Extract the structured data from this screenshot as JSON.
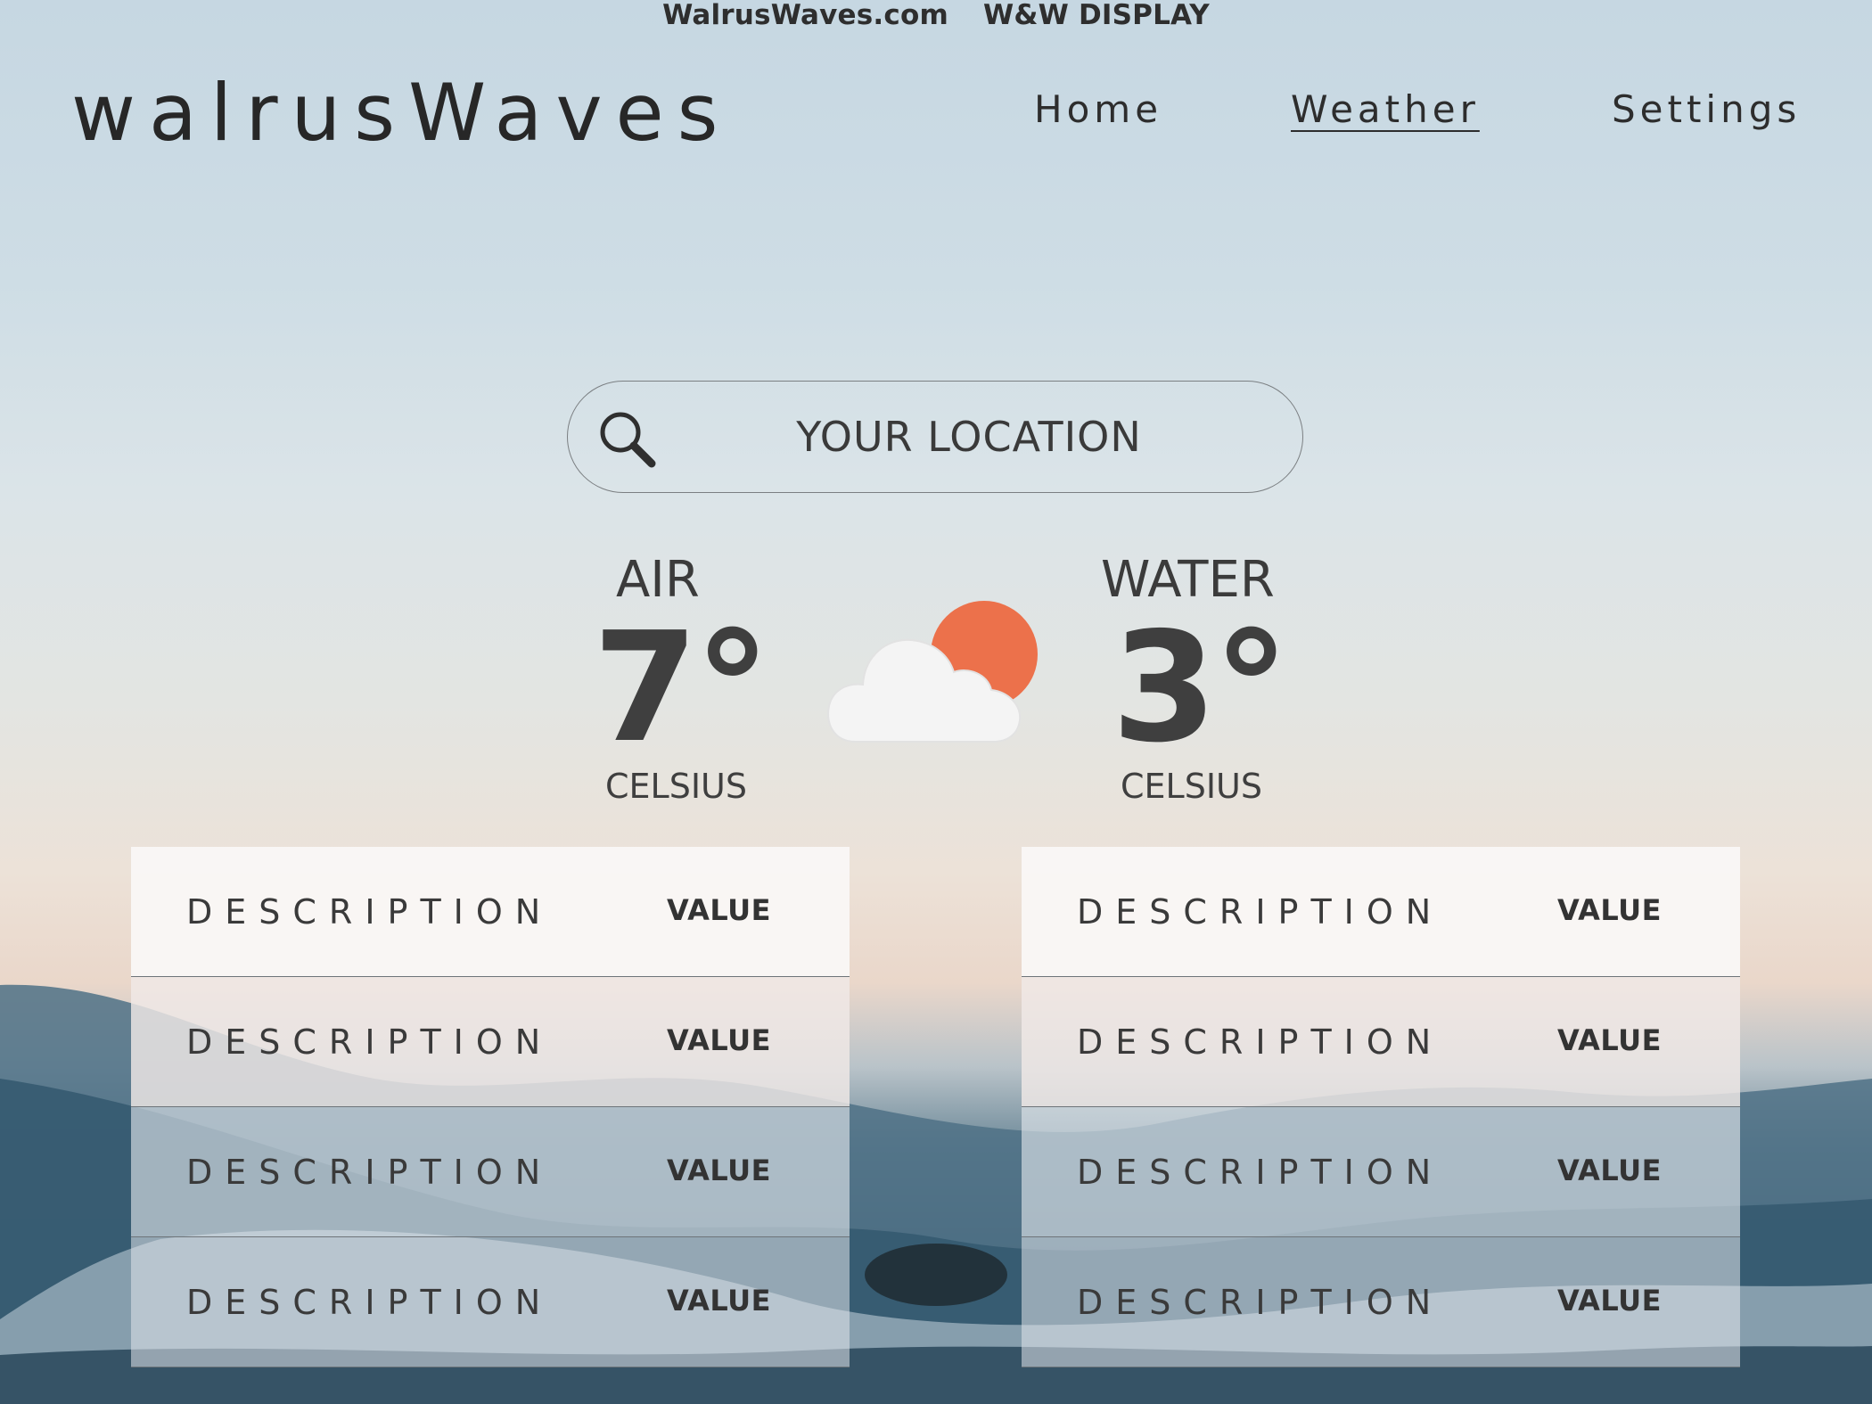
{
  "topbar": {
    "site": "WalrusWaves.com",
    "tag": "W&W DISPLAY"
  },
  "brand": {
    "logo": "walrusWaves"
  },
  "nav": {
    "items": [
      {
        "label": "Home",
        "active": false
      },
      {
        "label": "Weather",
        "active": true
      },
      {
        "label": "Settings",
        "active": false
      }
    ]
  },
  "search": {
    "placeholder": "YOUR LOCATION",
    "icon": "search-icon"
  },
  "air": {
    "label": "AIR",
    "value": "7°",
    "unit": "CELSIUS"
  },
  "water": {
    "label": "WATER",
    "value": "3°",
    "unit": "CELSIUS"
  },
  "condition": {
    "icon": "partly-cloudy-icon",
    "sun_color": "#ec714b",
    "cloud_color": "#f4f4f4"
  },
  "tables": {
    "left": [
      {
        "description": "DESCRIPTION",
        "value": "VALUE"
      },
      {
        "description": "DESCRIPTION",
        "value": "VALUE"
      },
      {
        "description": "DESCRIPTION",
        "value": "VALUE"
      },
      {
        "description": "DESCRIPTION",
        "value": "VALUE"
      }
    ],
    "right": [
      {
        "description": "DESCRIPTION",
        "value": "VALUE"
      },
      {
        "description": "DESCRIPTION",
        "value": "VALUE"
      },
      {
        "description": "DESCRIPTION",
        "value": "VALUE"
      },
      {
        "description": "DESCRIPTION",
        "value": "VALUE"
      }
    ]
  }
}
